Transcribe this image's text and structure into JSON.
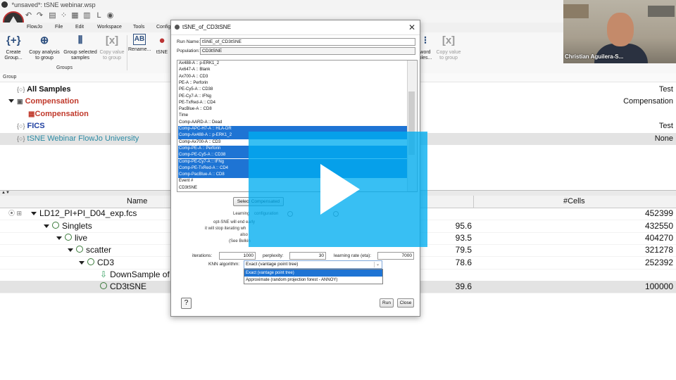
{
  "window": {
    "title": "*unsaved*: tSNE webinar.wsp"
  },
  "ribbon_tabs": [
    "FlowJo",
    "File",
    "Edit",
    "Workspace",
    "Tools",
    "Configu"
  ],
  "ribbon": {
    "buttons": [
      {
        "label": "Create Group...",
        "icon": "create-group-icon"
      },
      {
        "label": "Copy analysis to group",
        "icon": "copy-analysis-icon"
      },
      {
        "label": "Group selected samples",
        "icon": "group-samples-icon"
      },
      {
        "label": "Copy value to group",
        "icon": "copy-value-icon",
        "disabled": true
      },
      {
        "label": "Rename...",
        "icon": "rename-icon"
      },
      {
        "label": "tSNE",
        "icon": "tsne-icon"
      },
      {
        "label": "word ples...",
        "icon": "keyword-icon"
      },
      {
        "label": "Copy value to group",
        "icon": "copy-value-icon",
        "disabled": true
      }
    ],
    "group_label": "Groups"
  },
  "groups_panel": {
    "header": "Group",
    "rows": [
      {
        "name": "All Samples",
        "value": "Test",
        "color": "#000000"
      },
      {
        "name": "Compensation",
        "value": "Compensation",
        "color": "#c0392b"
      },
      {
        "name": "Compensation",
        "value": "",
        "color": "#c0392b"
      },
      {
        "name": "FICS",
        "value": "Test",
        "color": "#1f3fa0"
      },
      {
        "name": "tSNE Webinar FlowJo University",
        "value": "None",
        "color": "#2b8aa3"
      }
    ]
  },
  "samples_table": {
    "columns": [
      "Name",
      "#Cells"
    ],
    "rows": [
      {
        "name": "LD12_PI+PI_D04_exp.fcs",
        "pct": "",
        "cells": "452399"
      },
      {
        "name": "Singlets",
        "pct": "95.6",
        "cells": "432550"
      },
      {
        "name": "live",
        "pct": "93.5",
        "cells": "404270"
      },
      {
        "name": "scatter",
        "pct": "79.5",
        "cells": "321278"
      },
      {
        "name": "CD3",
        "pct": "78.6",
        "cells": "252392"
      },
      {
        "name": "DownSample of C",
        "pct": "",
        "cells": ""
      },
      {
        "name": "CD3tSNE",
        "pct": "39.6",
        "cells": "100000"
      }
    ]
  },
  "webcam": {
    "name": "Christian Aguilera-S..."
  },
  "dialog": {
    "title": "tSNE_of_CD3tSNE",
    "run_name_label": "Run Name:",
    "run_name_value": "tSNE_of_CD3tSNE",
    "population_label": "Population:",
    "population_value": "CD3tSNE",
    "parameters": [
      {
        "label": "Ax488-A :: p-ERK1_2",
        "selected": false
      },
      {
        "label": "Ax647-A :: Blank",
        "selected": false
      },
      {
        "label": "Ax700-A :: CD3",
        "selected": false
      },
      {
        "label": "PE-A :: Perforin",
        "selected": false
      },
      {
        "label": "PE-Cy5-A :: CD38",
        "selected": false
      },
      {
        "label": "PE-Cy7-A :: IFNg",
        "selected": false
      },
      {
        "label": "PE-TxRed-A :: CD4",
        "selected": false
      },
      {
        "label": "PacBlue-A :: CD8",
        "selected": false
      },
      {
        "label": "Time",
        "selected": false
      },
      {
        "label": "Comp-AARD-A :: Dead",
        "selected": false
      },
      {
        "label": "Comp-APC-H7-A :: HLA-DR",
        "selected": true
      },
      {
        "label": "Comp-Ax488-A :: p-ERK1_2",
        "selected": true
      },
      {
        "label": "Comp-Ax700-A :: CD3",
        "selected": false
      },
      {
        "label": "Comp-PE-A :: Perforin",
        "selected": true
      },
      {
        "label": "Comp-PE-Cy5-A :: CD38",
        "selected": true
      },
      {
        "label": "Comp-PE-Cy7-A :: IFNg",
        "selected": true
      },
      {
        "label": "Comp-PE-TxRed-A :: CD4",
        "selected": true
      },
      {
        "label": "Comp-PacBlue-A :: CD8",
        "selected": true
      },
      {
        "label": "Event #",
        "selected": false
      },
      {
        "label": "CD3tSNE",
        "selected": false
      }
    ],
    "select_compensated_label": "Select Compensated",
    "learning_label": "Learning",
    "learning_configuration": "configuration",
    "optsne_text_1": "opt-SNE will end early",
    "optsne_text_2": "it will stop iterating wh",
    "optsne_text_3": "also",
    "optsne_text_4": "(See Belkin",
    "iterations_label": "iterations:",
    "iterations_value": "1000",
    "perplexity_label": "perplexity:",
    "perplexity_value": "30",
    "eta_label": "learning rate (eta):",
    "eta_value": "7000",
    "knn_label": "KNN algorithm:",
    "knn_value": "Exact (vantage point tree)",
    "knn_options": [
      {
        "label": "Exact (vantage point tree)",
        "selected": true
      },
      {
        "label": "Approximate (random projection forest - ANNOY)",
        "selected": false
      }
    ],
    "help_label": "?",
    "run_label": "Run",
    "close_label": "Close"
  }
}
